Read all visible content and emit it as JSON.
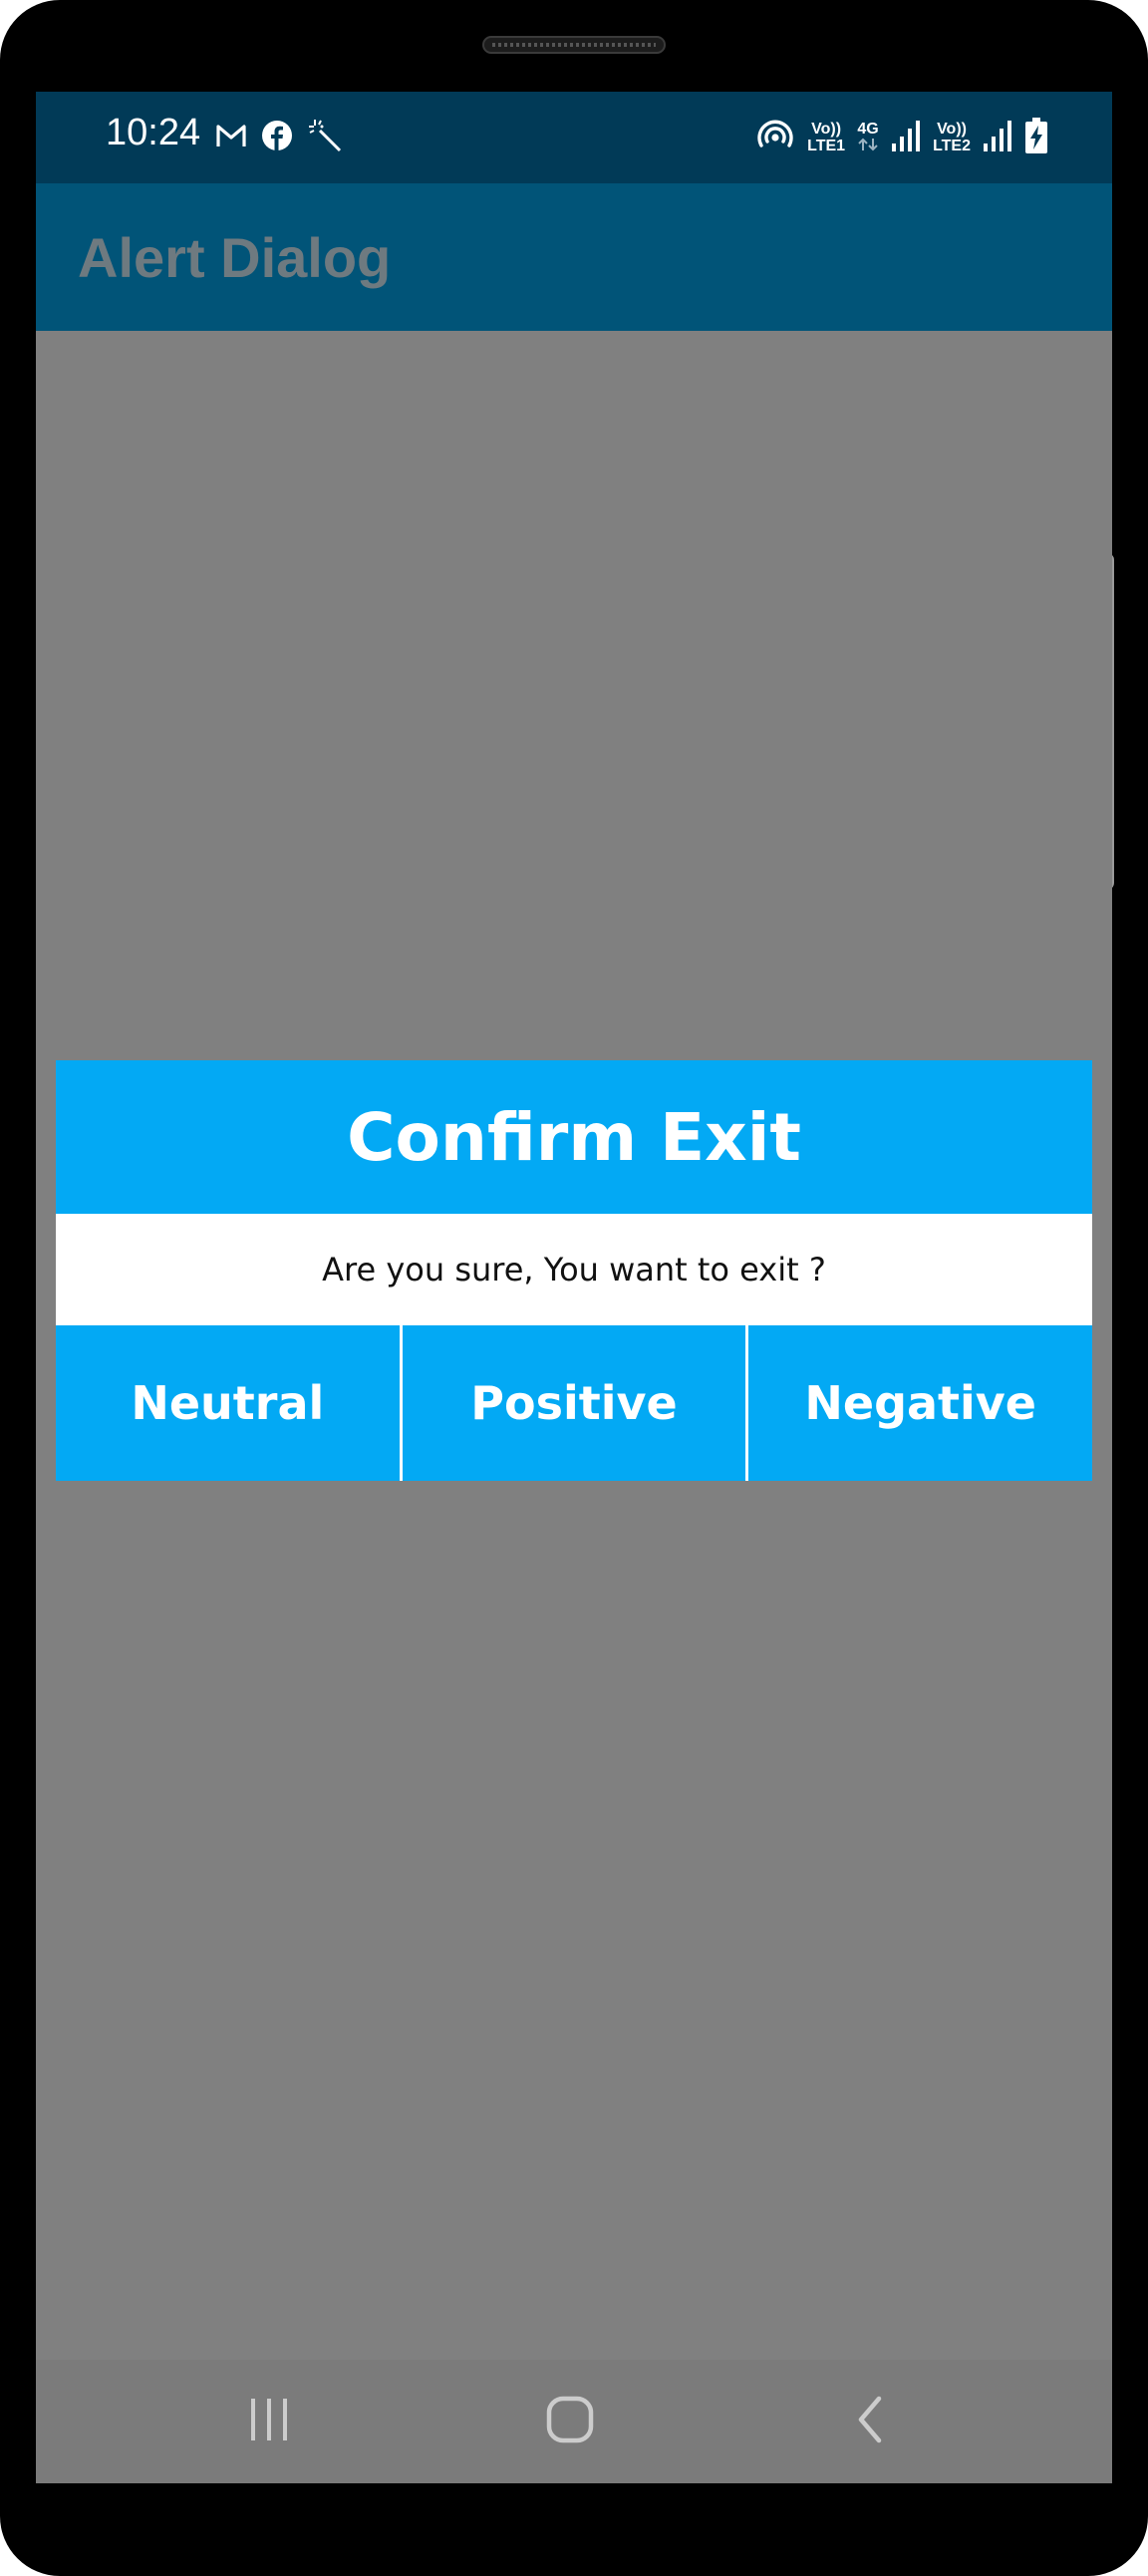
{
  "status_bar": {
    "time": "10:24",
    "left_icons": [
      "gmail-icon",
      "facebook-icon",
      "magic-wand-icon"
    ],
    "right_icons": [
      "hotspot-icon",
      "volte-lte1-icon",
      "4g-data-icon",
      "signal-icon",
      "volte-lte2-icon",
      "signal-icon",
      "battery-charging-icon"
    ],
    "sim1_volte": "Vo))",
    "sim1_lte": "LTE1",
    "network_type": "4G",
    "sim2_volte": "Vo))",
    "sim2_lte": "LTE2"
  },
  "app_bar": {
    "title": "Alert Dialog"
  },
  "dialog": {
    "title": "Confirm Exit",
    "message": "Are you sure, You want to exit ?",
    "buttons": {
      "neutral": "Neutral",
      "positive": "Positive",
      "negative": "Negative"
    }
  },
  "nav_bar": {
    "icons": [
      "recents-icon",
      "home-icon",
      "back-icon"
    ]
  },
  "colors": {
    "status_bar": "#013a57",
    "app_bar": "#015478",
    "app_title": "#6e7a80",
    "scrim": "#808080",
    "dialog_accent": "#03a9f4",
    "dialog_body": "#ffffff",
    "nav_bar": "#7b7b7b"
  }
}
